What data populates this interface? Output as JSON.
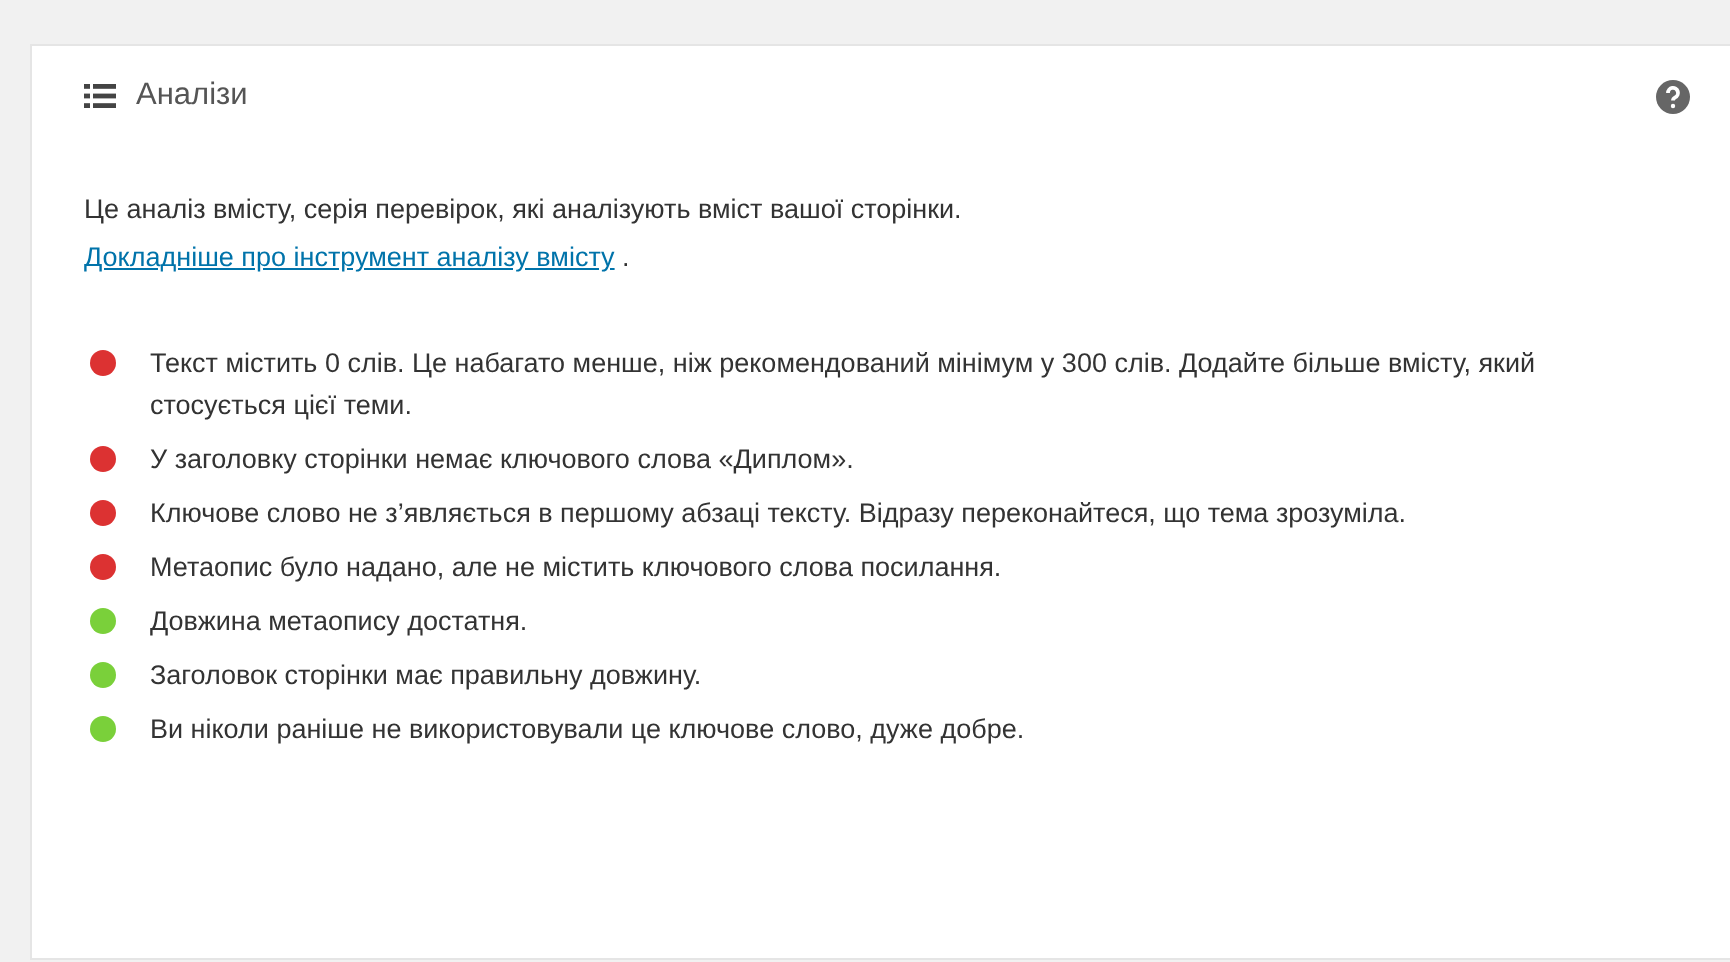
{
  "panel": {
    "title": "Аналізи",
    "intro": {
      "text": "Це аналіз вмісту, серія перевірок, які аналізують вміст вашої сторінки.",
      "link": "Докладніше про інструмент аналізу вмісту",
      "after": "."
    }
  },
  "results": [
    {
      "text": "Текст містить 0 слів. Це набагато менше, ніж рекомендований мінімум у 300 слів. Додайте більше вмісту, який стосується цієї теми.",
      "color": "#dc3232"
    },
    {
      "text": "У заголовку сторінки немає ключового слова «Диплом».",
      "color": "#dc3232"
    },
    {
      "text": "Ключове слово не з’являється в першому абзаці тексту. Відразу переконайтеся, що тема зрозуміла.",
      "color": "#dc3232"
    },
    {
      "text": "Метаопис було надано, але не містить ключового слова посилання.",
      "color": "#dc3232"
    },
    {
      "text": "Довжина метаопису достатня.",
      "color": "#7ad03a"
    },
    {
      "text": "Заголовок сторінки має правильну довжину.",
      "color": "#7ad03a"
    },
    {
      "text": "Ви ніколи раніше не використовували це ключове слово, дуже добре.",
      "color": "#7ad03a"
    }
  ]
}
